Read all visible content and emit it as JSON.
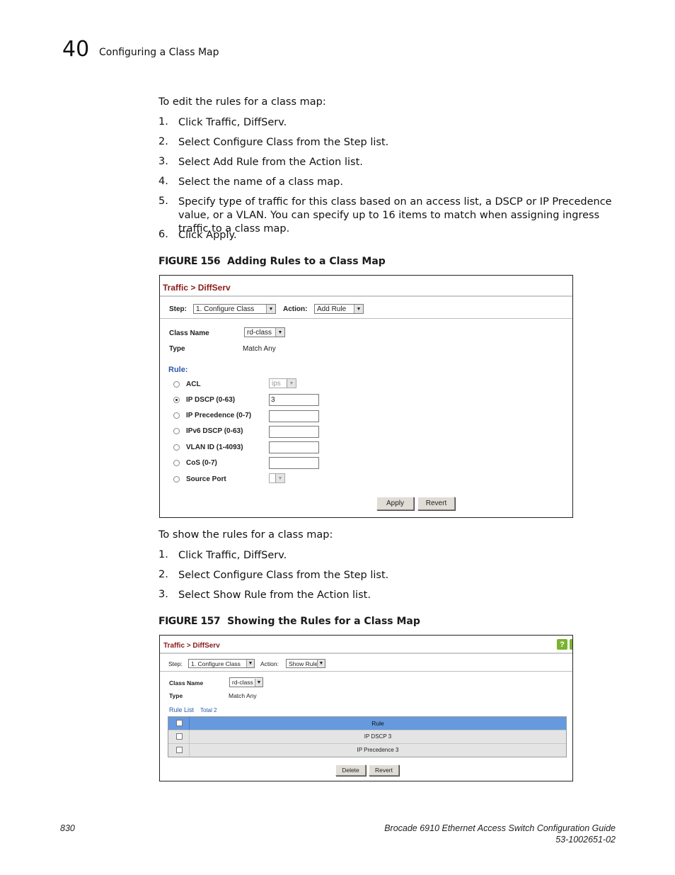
{
  "header": {
    "chapter_number": "40",
    "chapter_title": "Configuring a Class Map"
  },
  "section1": {
    "intro": "To edit the rules for a class map:",
    "steps": [
      {
        "num": "1.",
        "text": "Click Traffic, DiffServ."
      },
      {
        "num": "2.",
        "text": "Select Configure Class from the Step list."
      },
      {
        "num": "3.",
        "text": "Select Add Rule from the Action list."
      },
      {
        "num": "4.",
        "text": "Select the name of a class map."
      },
      {
        "num": "5.",
        "text": "Specify type of traffic for this class based on an access list, a DSCP or IP Precedence value, or a VLAN. You can specify up to 16 items to match when assigning ingress traffic to a class map."
      },
      {
        "num": "6.",
        "text": "Click Apply."
      }
    ]
  },
  "figure156": {
    "label": "FIGURE 156",
    "title": "Adding Rules to a Class Map",
    "breadcrumb": "Traffic > DiffServ",
    "step_label": "Step:",
    "step_value": "1. Configure Class",
    "action_label": "Action:",
    "action_value": "Add Rule",
    "class_name_label": "Class Name",
    "class_name_value": "rd-class",
    "type_label": "Type",
    "type_value": "Match Any",
    "rule_label": "Rule:",
    "rules": [
      {
        "label": "ACL",
        "selected": false,
        "control": "select",
        "value": "ips"
      },
      {
        "label": "IP DSCP (0-63)",
        "selected": true,
        "control": "text",
        "value": "3"
      },
      {
        "label": "IP Precedence (0-7)",
        "selected": false,
        "control": "text",
        "value": ""
      },
      {
        "label": "IPv6 DSCP (0-63)",
        "selected": false,
        "control": "text",
        "value": ""
      },
      {
        "label": "VLAN ID (1-4093)",
        "selected": false,
        "control": "text",
        "value": ""
      },
      {
        "label": "CoS (0-7)",
        "selected": false,
        "control": "text",
        "value": ""
      },
      {
        "label": "Source Port",
        "selected": false,
        "control": "select",
        "value": ""
      }
    ],
    "apply_label": "Apply",
    "revert_label": "Revert"
  },
  "section2": {
    "intro": "To show the rules for a class map:",
    "steps": [
      {
        "num": "1.",
        "text": "Click Traffic, DiffServ."
      },
      {
        "num": "2.",
        "text": "Select Configure Class from the Step list."
      },
      {
        "num": "3.",
        "text": "Select Show Rule from the Action list."
      }
    ]
  },
  "figure157": {
    "label": "FIGURE 157",
    "title": "Showing the Rules for a Class Map",
    "breadcrumb": "Traffic > DiffServ",
    "help_icon": "?",
    "step_label": "Step:",
    "step_value": "1. Configure Class",
    "action_label": "Action:",
    "action_value": "Show Rule",
    "class_name_label": "Class Name",
    "class_name_value": "rd-class",
    "type_label": "Type",
    "type_value": "Match Any",
    "rule_list_label": "Rule List",
    "rule_list_total": "Total 2",
    "table_header": "Rule",
    "rows": [
      "IP DSCP 3",
      "IP Precedence 3"
    ],
    "delete_label": "Delete",
    "revert_label": "Revert",
    "colors": {
      "header_bg": "#6699dd",
      "row_bg": "#e4e4e4",
      "help_green": "#7ab32e"
    }
  },
  "footer": {
    "page_number": "830",
    "doc_title": "Brocade 6910 Ethernet Access Switch Configuration Guide",
    "doc_number": "53-1002651-02"
  }
}
